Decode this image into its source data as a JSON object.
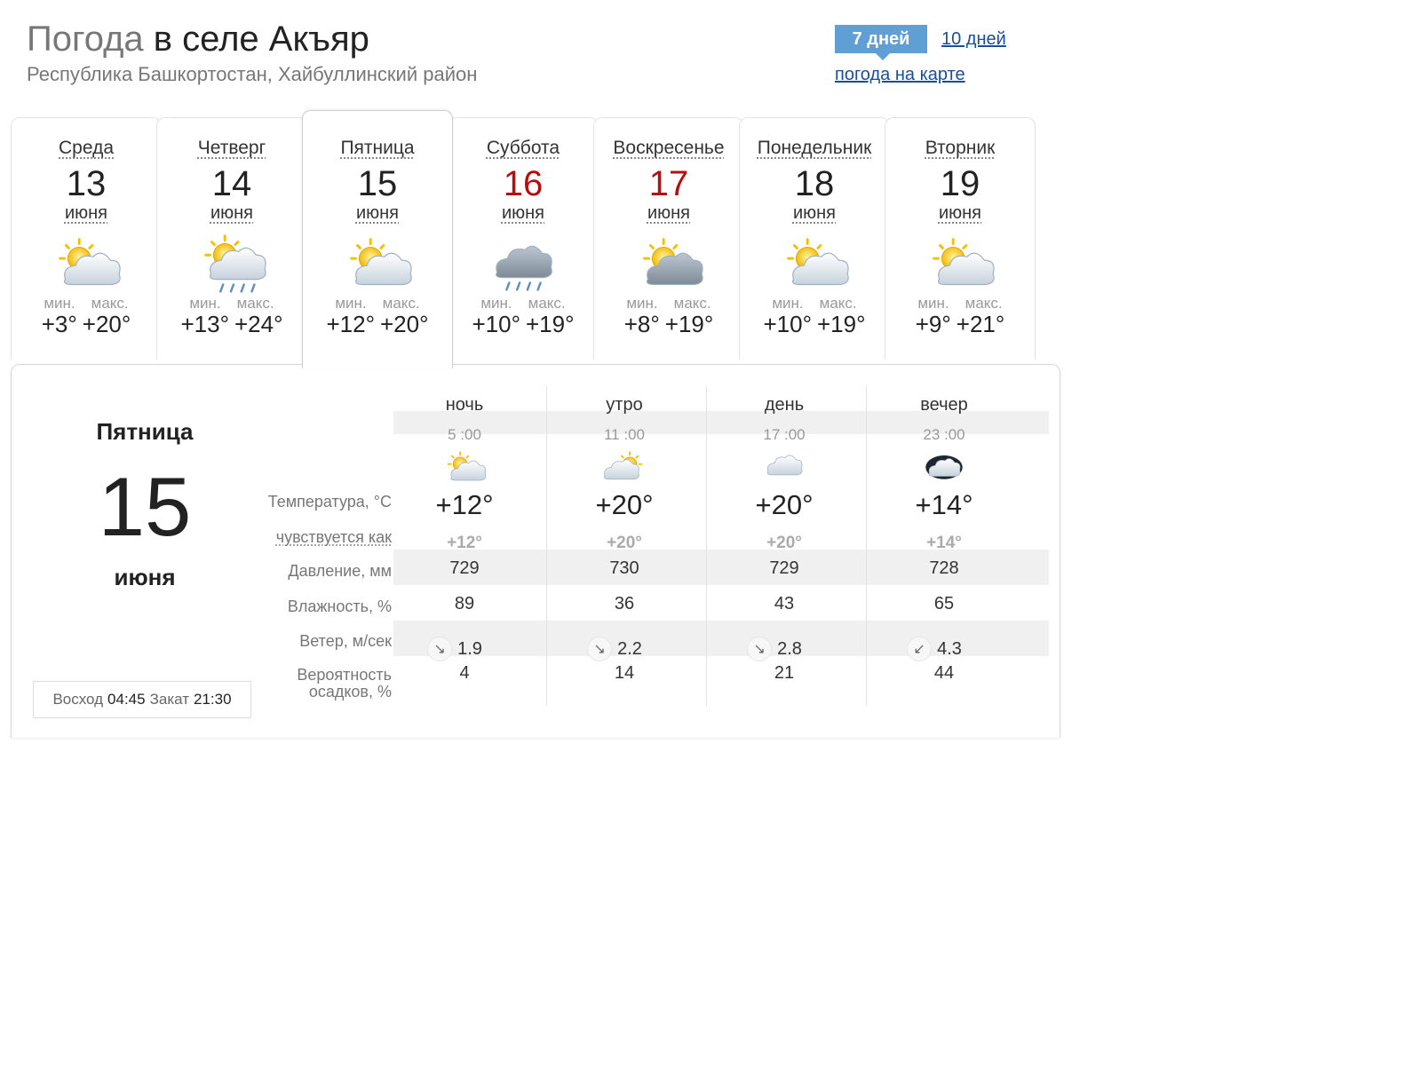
{
  "header": {
    "title_prefix": "Погода",
    "title_location": "в селе Акъяр",
    "subtitle": "Республика Башкортостан, Хайбуллинский район"
  },
  "period": {
    "active": "7 дней",
    "ten_days": "10 дней",
    "map_link": "погода на карте"
  },
  "days": [
    {
      "name": "Среда",
      "num": "13",
      "month": "июня",
      "icon": "partly-cloudy-icon",
      "min_label": "мин.",
      "max_label": "макс.",
      "min": "+3°",
      "max": "+20°"
    },
    {
      "name": "Четверг",
      "num": "14",
      "month": "июня",
      "icon": "partly-cloudy-rain-icon",
      "min_label": "мин.",
      "max_label": "макс.",
      "min": "+13°",
      "max": "+24°"
    },
    {
      "name": "Пятница",
      "num": "15",
      "month": "июня",
      "icon": "partly-cloudy-icon",
      "min_label": "мин.",
      "max_label": "макс.",
      "min": "+12°",
      "max": "+20°"
    },
    {
      "name": "Суббота",
      "num": "16",
      "month": "июня",
      "icon": "cloud-rain-icon",
      "min_label": "мин.",
      "max_label": "макс.",
      "min": "+10°",
      "max": "+19°"
    },
    {
      "name": "Воскресенье",
      "num": "17",
      "month": "июня",
      "icon": "cloudy-sun-icon",
      "min_label": "мин.",
      "max_label": "макс.",
      "min": "+8°",
      "max": "+19°"
    },
    {
      "name": "Понедельник",
      "num": "18",
      "month": "июня",
      "icon": "partly-cloudy-icon",
      "min_label": "мин.",
      "max_label": "макс.",
      "min": "+10°",
      "max": "+19°"
    },
    {
      "name": "Вторник",
      "num": "19",
      "month": "июня",
      "icon": "partly-cloudy-icon",
      "min_label": "мин.",
      "max_label": "макс.",
      "min": "+9°",
      "max": "+21°"
    }
  ],
  "weekend_color": "#b80d0d",
  "accent_color": "#5f9fd3",
  "detail": {
    "day_name": "Пятница",
    "day_num": "15",
    "month": "июня",
    "sunrise_label": "Восход",
    "sunrise": "04:45",
    "sunset_label": "Закат",
    "sunset": "21:30",
    "labels": {
      "temperature": "Температура, °C",
      "feels_like": "чувствуется как",
      "pressure": "Давление, мм",
      "humidity": "Влажность, %",
      "wind": "Ветер, м/сек",
      "precip_line1": "Вероятность",
      "precip_line2": "осадков, %"
    },
    "periods": [
      {
        "name": "ночь",
        "time": "5 :00",
        "icon": "partly-cloudy-icon",
        "temp": "+12°",
        "feels": "+12°",
        "pressure": "729",
        "humidity": "89",
        "wind_dir": "↘",
        "wind": "1.9",
        "precip": "4"
      },
      {
        "name": "утро",
        "time": "11 :00",
        "icon": "sun-cloud-icon",
        "temp": "+20°",
        "feels": "+20°",
        "pressure": "730",
        "humidity": "36",
        "wind_dir": "↘",
        "wind": "2.2",
        "precip": "14"
      },
      {
        "name": "день",
        "time": "17 :00",
        "icon": "cloud-icon",
        "temp": "+20°",
        "feels": "+20°",
        "pressure": "729",
        "humidity": "43",
        "wind_dir": "↘",
        "wind": "2.8",
        "precip": "21"
      },
      {
        "name": "вечер",
        "time": "23 :00",
        "icon": "night-cloud-icon",
        "temp": "+14°",
        "feels": "+14°",
        "pressure": "728",
        "humidity": "65",
        "wind_dir": "↙",
        "wind": "4.3",
        "precip": "44"
      }
    ]
  }
}
